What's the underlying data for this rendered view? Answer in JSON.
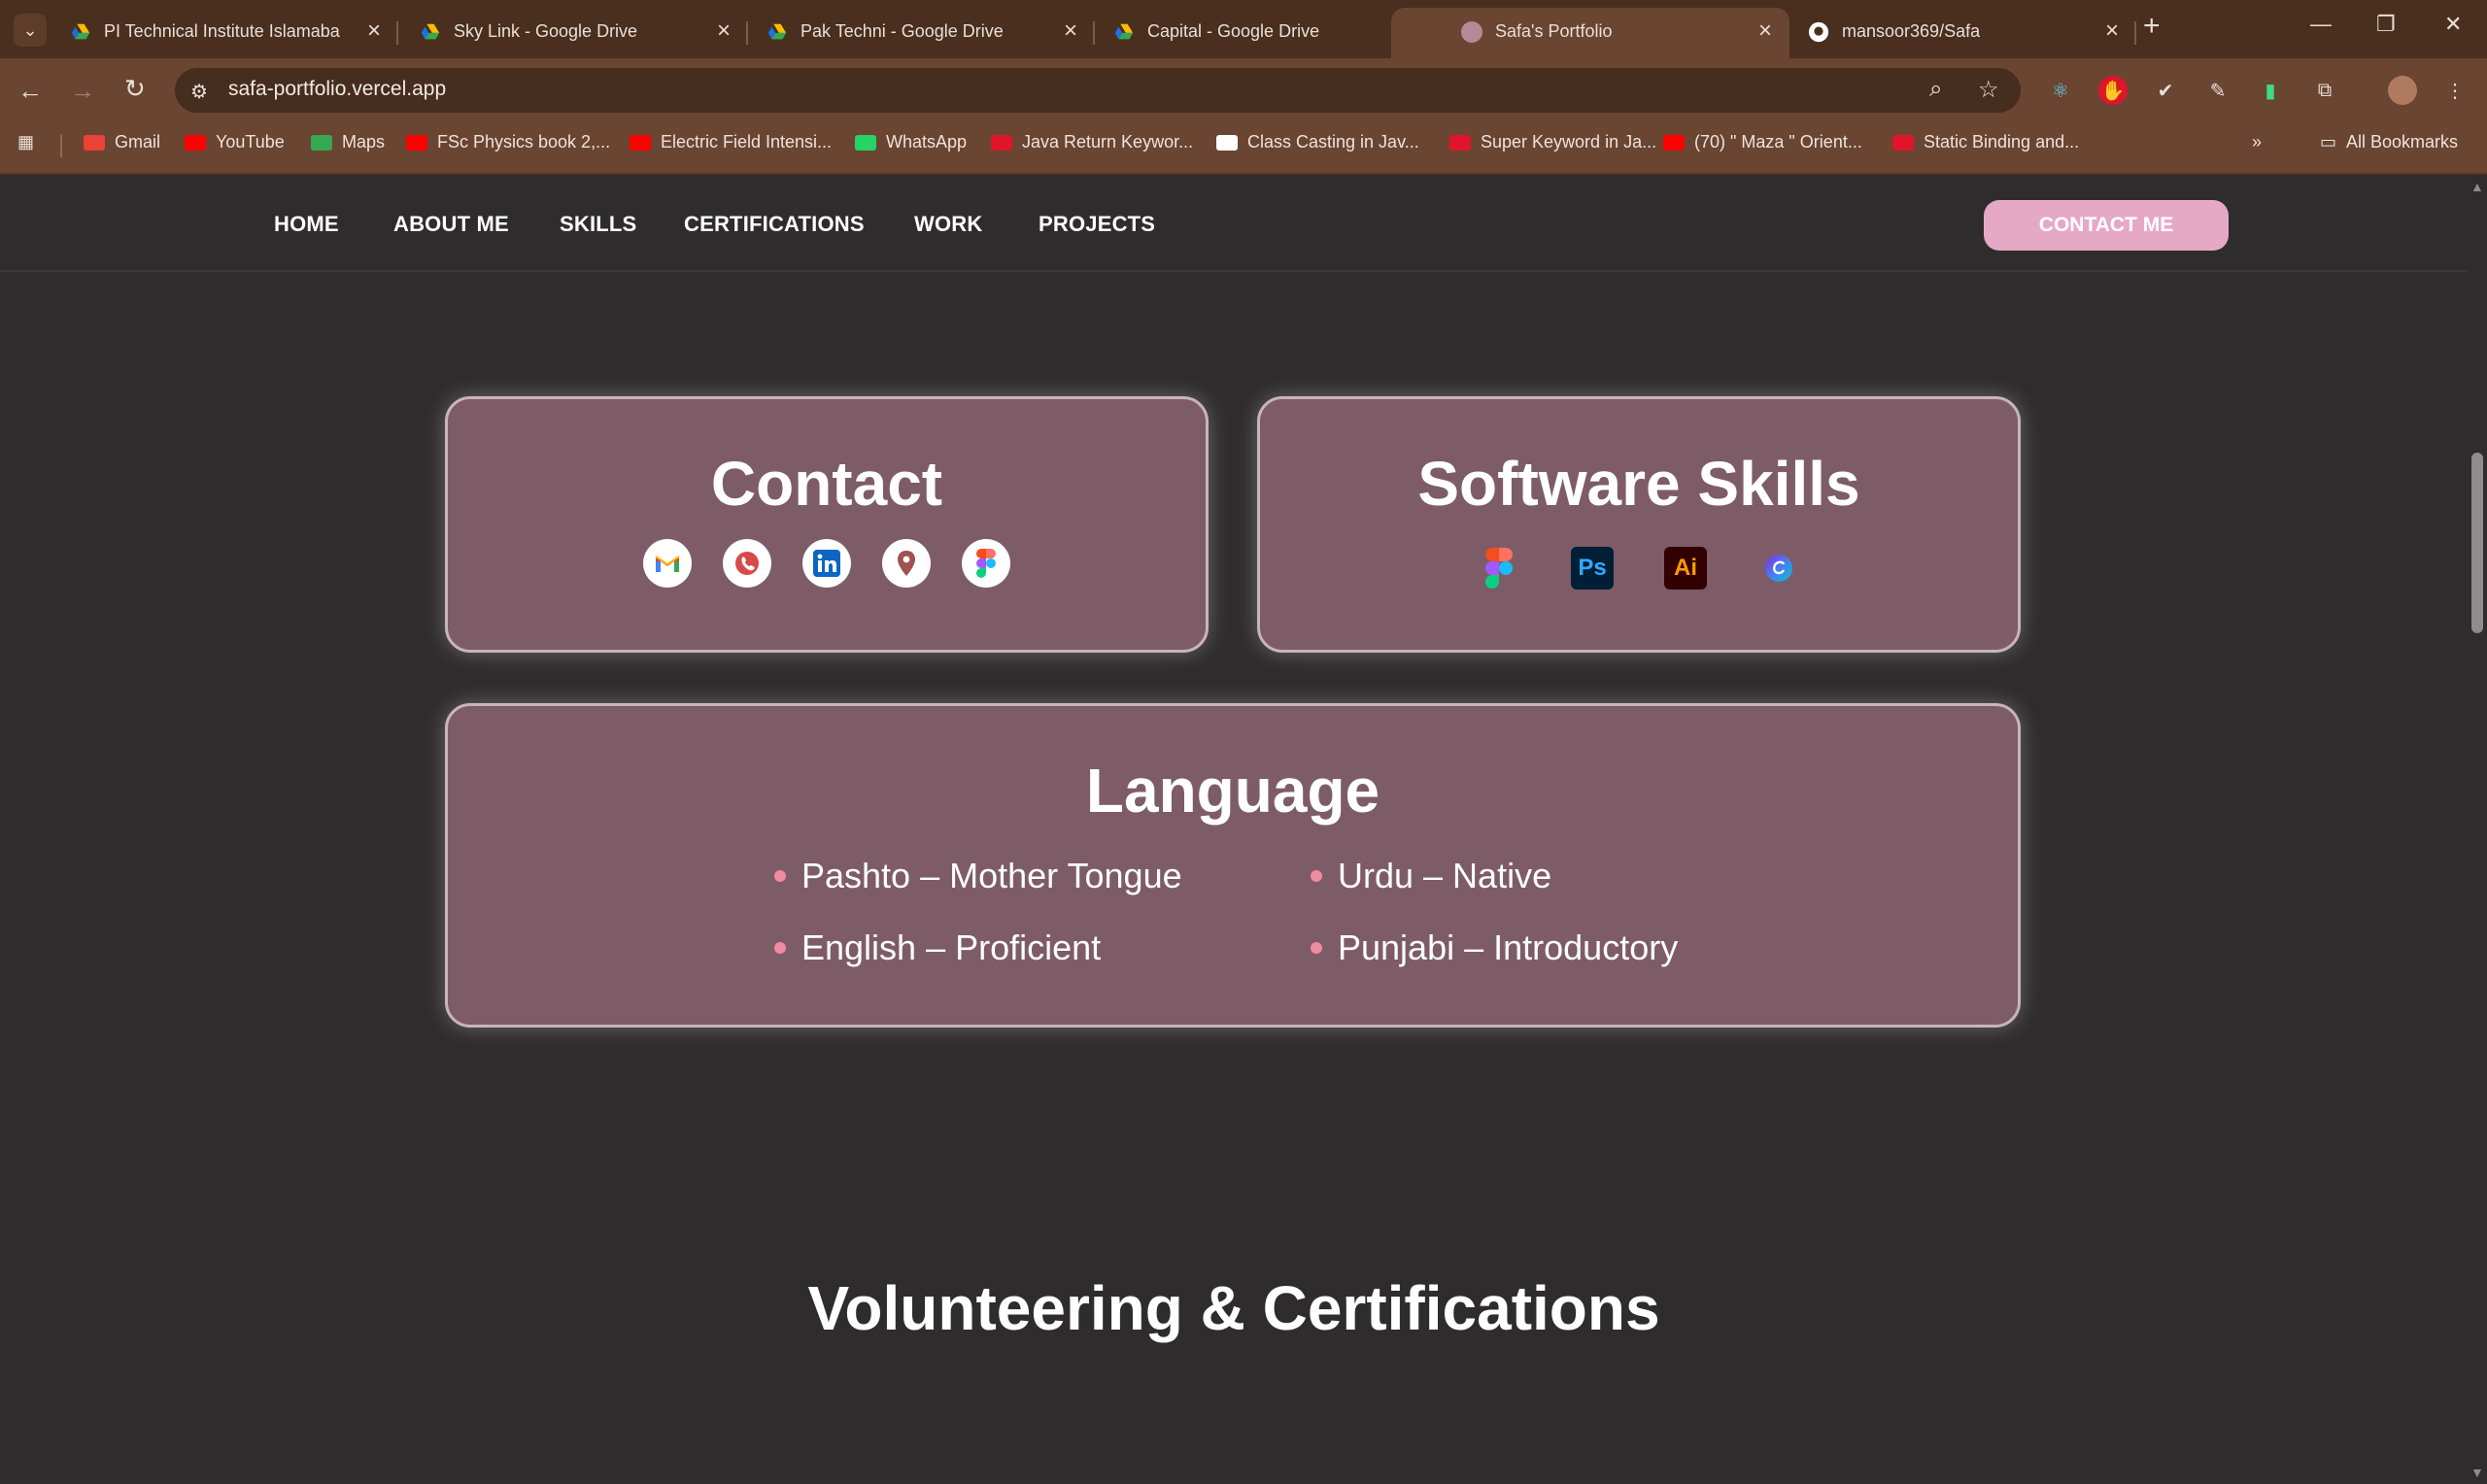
{
  "browser": {
    "tabs": [
      {
        "title": "PI Technical Institute Islamabad",
        "favicon": "google-drive-icon",
        "active": false
      },
      {
        "title": "Sky Link - Google Drive",
        "favicon": "google-drive-icon",
        "active": false
      },
      {
        "title": "Pak Techni - Google Drive",
        "favicon": "google-drive-icon",
        "active": false
      },
      {
        "title": "Capital - Google Drive",
        "favicon": "google-drive-icon",
        "active": false
      },
      {
        "title": "Safa's Portfolio",
        "favicon": "site-icon",
        "active": true
      },
      {
        "title": "mansoor369/Safa",
        "favicon": "github-icon",
        "active": false
      }
    ],
    "url": "safa-portfolio.vercel.app",
    "bookmarks": [
      {
        "label": "Gmail",
        "icon": "gmail-icon",
        "color": "#ea4335"
      },
      {
        "label": "YouTube",
        "icon": "youtube-icon",
        "color": "#ff0000"
      },
      {
        "label": "Maps",
        "icon": "maps-icon",
        "color": "#34a853"
      },
      {
        "label": "FSc Physics book 2,...",
        "icon": "youtube-icon",
        "color": "#ff0000"
      },
      {
        "label": "Electric Field Intensi...",
        "icon": "youtube-icon",
        "color": "#ff0000"
      },
      {
        "label": "WhatsApp",
        "icon": "whatsapp-icon",
        "color": "#25d366"
      },
      {
        "label": "Java Return Keywor...",
        "icon": "javatpoint-icon",
        "color": "#e0142a"
      },
      {
        "label": "Class Casting in Jav...",
        "icon": "scaler-icon",
        "color": "#ffffff"
      },
      {
        "label": "Super Keyword in Ja...",
        "icon": "javatpoint-icon",
        "color": "#e0142a"
      },
      {
        "label": "(70) \" Maza \" Orient...",
        "icon": "youtube-icon",
        "color": "#ff0000"
      },
      {
        "label": "Static Binding and...",
        "icon": "javatpoint-icon",
        "color": "#e0142a"
      }
    ],
    "all_bookmarks": "All Bookmarks"
  },
  "nav": {
    "links": [
      "HOME",
      "ABOUT ME",
      "SKILLS",
      "CERTIFICATIONS",
      "WORK",
      "PROJECTS"
    ],
    "contact_button": "CONTACT ME"
  },
  "contact": {
    "title": "Contact",
    "icons": [
      "gmail-icon",
      "phone-icon",
      "linkedin-icon",
      "location-icon",
      "figma-icon"
    ]
  },
  "software": {
    "title": "Software Skills",
    "icons": [
      {
        "name": "figma-icon",
        "label": ""
      },
      {
        "name": "photoshop-icon",
        "label": "Ps"
      },
      {
        "name": "illustrator-icon",
        "label": "Ai"
      },
      {
        "name": "canva-icon",
        "label": ""
      }
    ]
  },
  "language": {
    "title": "Language",
    "items": [
      "Pashto – Mother Tongue",
      "Urdu – Native",
      "English – Proficient",
      "Punjabi – Introductory"
    ]
  },
  "section": {
    "title": "Volunteering & Certifications"
  },
  "colors": {
    "card_bg": "#7d5c68",
    "accent_pink": "#e6a9c5",
    "bullet": "#f08aa3",
    "page_bg": "#2f2c2d"
  }
}
